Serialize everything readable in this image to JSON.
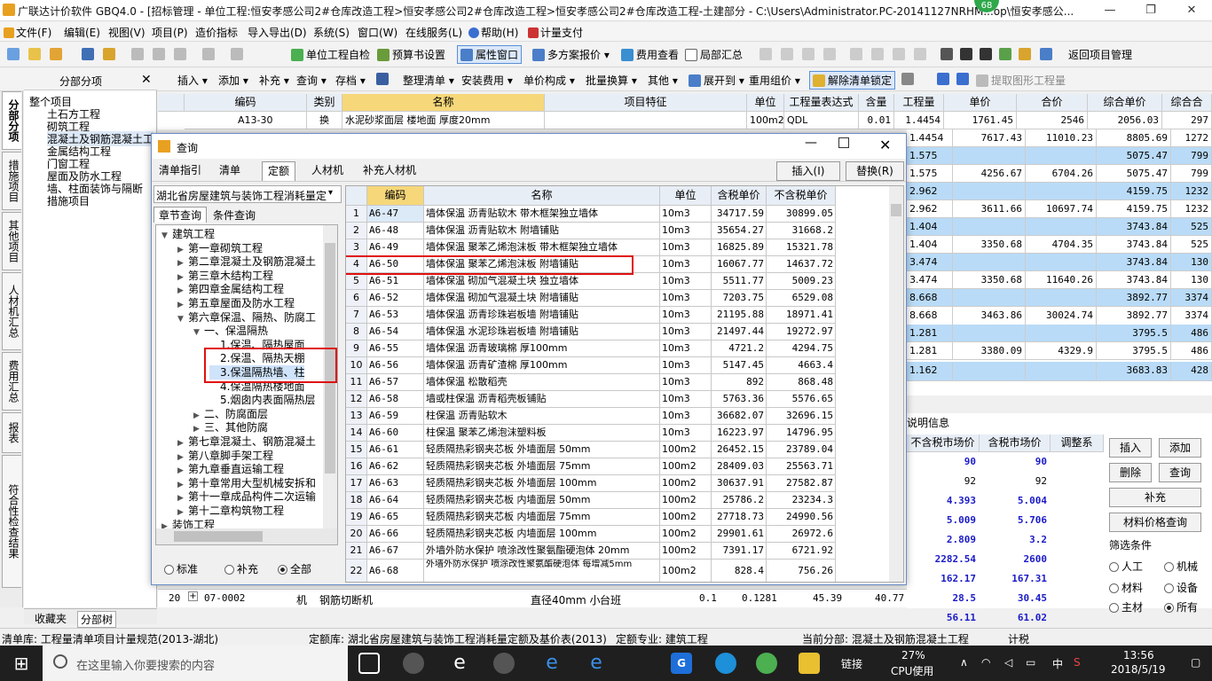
{
  "window": {
    "title": "广联达计价软件 GBQ4.0 - [招标管理 - 单位工程:恒安孝感公司2#仓库改造工程>恒安孝感公司2#仓库改造工程>恒安孝感公司2#仓库改造工程-土建部分 - C:\\Users\\Administrator.PC-20141127NRHM...op\\恒安孝感公...",
    "badge": "68",
    "min": "—",
    "restore": "❐",
    "close": "✕"
  },
  "menu": [
    "文件(F)",
    "编辑(E)",
    "视图(V)",
    "项目(P)",
    "造价指标",
    "导入导出(D)",
    "系统(S)",
    "窗口(W)",
    "在线服务(L)",
    "帮助(H)",
    "计量支付"
  ],
  "toolbar1": {
    "check": "单位工程自检",
    "budget": "预算书设置",
    "prop": "属性窗口",
    "multi": "多方案报价",
    "fee": "费用查看",
    "local": "局部汇总",
    "back": "返回项目管理"
  },
  "toolbar2": {
    "insert": "插入",
    "add": "添加",
    "supplement": "补充",
    "query": "查询",
    "save": "存档",
    "sort": "整理清单",
    "install": "安装费用",
    "unit": "单价构成",
    "batch": "批量换算",
    "other": "其他",
    "expand": "展开到",
    "reprice": "重用组价",
    "unlock": "解除清单锁定",
    "extract": "提取图形工程量"
  },
  "vtabs": [
    "分部分项",
    "措施项目",
    "其他项目",
    "人材机汇总",
    "费用汇总",
    "报表",
    "符合性检查结果"
  ],
  "left": {
    "header": "分部分项",
    "close": "✕",
    "root": "整个项目",
    "items": [
      "土石方工程",
      "砌筑工程",
      "混凝土及钢筋混凝土工",
      "金属结构工程",
      "门窗工程",
      "屋面及防水工程",
      "墙、柱面装饰与隔断",
      "措施项目"
    ],
    "tabs": [
      "收藏夹",
      "分部树"
    ]
  },
  "grid": {
    "headers": [
      "编码",
      "类别",
      "名称",
      "项目特征",
      "单位",
      "工程量表达式",
      "含量",
      "工程量",
      "单价",
      "合价",
      "综合单价",
      "综合合"
    ],
    "row1": {
      "code": "A13-30",
      "cat": "换",
      "name": "水泥砂浆面层 楼地面 厚度20mm",
      "unit": "100m2",
      "expr": "QDL",
      "content": "0.01",
      "qty": "1.4454",
      "price": "1761.45",
      "total": "2546",
      "cprice": "2056.03",
      "ctotal": "297"
    }
  },
  "right_rows": [
    {
      "qty": "1.4454",
      "price": "7617.43",
      "total": "11010.23",
      "cprice": "8805.69",
      "ctotal": "1272",
      "blue": false
    },
    {
      "qty": "1.575",
      "price": "",
      "total": "",
      "cprice": "5075.47",
      "ctotal": "799",
      "blue": true
    },
    {
      "qty": "1.575",
      "price": "4256.67",
      "total": "6704.26",
      "cprice": "5075.47",
      "ctotal": "799",
      "blue": false
    },
    {
      "qty": "2.962",
      "price": "",
      "total": "",
      "cprice": "4159.75",
      "ctotal": "1232",
      "blue": true
    },
    {
      "qty": "2.962",
      "price": "3611.66",
      "total": "10697.74",
      "cprice": "4159.75",
      "ctotal": "1232",
      "blue": false
    },
    {
      "qty": "1.404",
      "price": "",
      "total": "",
      "cprice": "3743.84",
      "ctotal": "525",
      "blue": true
    },
    {
      "qty": "1.404",
      "price": "3350.68",
      "total": "4704.35",
      "cprice": "3743.84",
      "ctotal": "525",
      "blue": false
    },
    {
      "qty": "3.474",
      "price": "",
      "total": "",
      "cprice": "3743.84",
      "ctotal": "130",
      "blue": true
    },
    {
      "qty": "3.474",
      "price": "3350.68",
      "total": "11640.26",
      "cprice": "3743.84",
      "ctotal": "130",
      "blue": false
    },
    {
      "qty": "8.668",
      "price": "",
      "total": "",
      "cprice": "3892.77",
      "ctotal": "3374",
      "blue": true
    },
    {
      "qty": "8.668",
      "price": "3463.86",
      "total": "30024.74",
      "cprice": "3892.77",
      "ctotal": "3374",
      "blue": false
    },
    {
      "qty": "1.281",
      "price": "",
      "total": "",
      "cprice": "3795.5",
      "ctotal": "486",
      "blue": true
    },
    {
      "qty": "1.281",
      "price": "3380.09",
      "total": "4329.9",
      "cprice": "3795.5",
      "ctotal": "486",
      "blue": false
    },
    {
      "qty": "1.162",
      "price": "",
      "total": "",
      "cprice": "3683.83",
      "ctotal": "428",
      "blue": true
    }
  ],
  "bottom": {
    "tab": "说明信息",
    "headers": [
      "不含税市场价",
      "含税市场价",
      "调整系"
    ],
    "rows": [
      {
        "a": "90",
        "b": "90",
        "bold": true
      },
      {
        "a": "92",
        "b": "92",
        "bold": false
      },
      {
        "a": "4.393",
        "b": "5.004",
        "bold": true
      },
      {
        "a": "5.009",
        "b": "5.706",
        "bold": true
      },
      {
        "a": "2.809",
        "b": "3.2",
        "bold": true
      },
      {
        "a": "2282.54",
        "b": "2600",
        "bold": true
      },
      {
        "a": "162.17",
        "b": "167.31",
        "bold": true
      },
      {
        "a": "28.5",
        "b": "30.45",
        "bold": true
      },
      {
        "a": "56.11",
        "b": "61.02",
        "bold": true
      }
    ],
    "buttons": {
      "insert": "插入",
      "add": "添加",
      "delete": "删除",
      "query": "查询",
      "supplement": "补充",
      "material": "材料价格查询"
    },
    "filter": {
      "title": "筛选条件",
      "opts": [
        "人工",
        "机械",
        "材料",
        "设备",
        "主材",
        "所有"
      ]
    }
  },
  "row20": {
    "no": "20",
    "code": "07-0002",
    "cat": "机",
    "name": "钢筋切断机",
    "spec": "直径40mm 小",
    "unit": "台班",
    "v1": "0.1",
    "v2": "0.1281",
    "v3": "45.39",
    "v4": "40.77"
  },
  "status": {
    "list": "清单库:  工程量清单项目计量规范(2013-湖北)",
    "quota": "定额库:  湖北省房屋建筑与装饰工程消耗量定额及基价表(2013)",
    "major": "定额专业:  建筑工程",
    "current": "当前分部:  混凝土及钢筋混凝土工程",
    "tax": "计税"
  },
  "taskbar": {
    "search": "在这里输入你要搜索的内容",
    "link": "链接",
    "cpu": "27%",
    "cpu_label": "CPU使用",
    "ime": "中",
    "time": "13:56",
    "date": "2018/5/19"
  },
  "dialog": {
    "title": "查询",
    "tabs": [
      "清单指引",
      "清单",
      "定额",
      "人材机",
      "补充人材机"
    ],
    "insert": "插入(I)",
    "replace": "替换(R)",
    "lib": "湖北省房屋建筑与装饰工程消耗量定",
    "subtabs": [
      "章节查询",
      "条件查询"
    ],
    "tree": [
      {
        "t": "建筑工程",
        "l": 0,
        "ar": "v"
      },
      {
        "t": "第一章砌筑工程",
        "l": 1,
        "ar": ">"
      },
      {
        "t": "第二章混凝土及钢筋混凝土",
        "l": 1,
        "ar": ">"
      },
      {
        "t": "第三章木结构工程",
        "l": 1,
        "ar": ">"
      },
      {
        "t": "第四章金属结构工程",
        "l": 1,
        "ar": ">"
      },
      {
        "t": "第五章屋面及防水工程",
        "l": 1,
        "ar": ">"
      },
      {
        "t": "第六章保温、隔热、防腐工",
        "l": 1,
        "ar": "v"
      },
      {
        "t": "一、保温隔热",
        "l": 2,
        "ar": "v"
      },
      {
        "t": "1.保温、隔热屋面",
        "l": 3,
        "ar": ""
      },
      {
        "t": "2.保温、隔热天棚",
        "l": 3,
        "ar": ""
      },
      {
        "t": "3.保温隔热墙、柱",
        "l": 3,
        "ar": "",
        "sel": true
      },
      {
        "t": "4.保温隔热楼地面",
        "l": 3,
        "ar": ""
      },
      {
        "t": "5.烟囱内表面隔热层",
        "l": 3,
        "ar": ""
      },
      {
        "t": "二、防腐面层",
        "l": 2,
        "ar": ">"
      },
      {
        "t": "三、其他防腐",
        "l": 2,
        "ar": ">"
      },
      {
        "t": "第七章混凝土、钢筋混凝土",
        "l": 1,
        "ar": ">"
      },
      {
        "t": "第八章脚手架工程",
        "l": 1,
        "ar": ">"
      },
      {
        "t": "第九章垂直运输工程",
        "l": 1,
        "ar": ">"
      },
      {
        "t": "第十章常用大型机械安拆和",
        "l": 1,
        "ar": ">"
      },
      {
        "t": "第十一章成品构件二次运输",
        "l": 1,
        "ar": ">"
      },
      {
        "t": "第十二章构筑物工程",
        "l": 1,
        "ar": ">"
      },
      {
        "t": "装饰工程",
        "l": 0,
        "ar": ">"
      }
    ],
    "radios": [
      "标准",
      "补充",
      "全部"
    ],
    "headers": [
      "编码",
      "名称",
      "单位",
      "含税单价",
      "不含税单价"
    ],
    "rows": [
      [
        "1",
        "A6-47",
        "墙体保温 沥青贴软木 带木框架独立墙体",
        "10m3",
        "34717.59",
        "30899.05"
      ],
      [
        "2",
        "A6-48",
        "墙体保温 沥青贴软木 附墙铺贴",
        "10m3",
        "35654.27",
        "31668.2"
      ],
      [
        "3",
        "A6-49",
        "墙体保温 聚苯乙烯泡沫板 带木框架独立墙体",
        "10m3",
        "16825.89",
        "15321.78"
      ],
      [
        "4",
        "A6-50",
        "墙体保温 聚苯乙烯泡沫板 附墙铺贴",
        "10m3",
        "16067.77",
        "14637.72"
      ],
      [
        "5",
        "A6-51",
        "墙体保温 砌加气混凝土块 独立墙体",
        "10m3",
        "5511.77",
        "5009.23"
      ],
      [
        "6",
        "A6-52",
        "墙体保温 砌加气混凝土块 附墙铺贴",
        "10m3",
        "7203.75",
        "6529.08"
      ],
      [
        "7",
        "A6-53",
        "墙体保温 沥青珍珠岩板墙 附墙铺贴",
        "10m3",
        "21195.88",
        "18971.41"
      ],
      [
        "8",
        "A6-54",
        "墙体保温 水泥珍珠岩板墙 附墙铺贴",
        "10m3",
        "21497.44",
        "19272.97"
      ],
      [
        "9",
        "A6-55",
        "墙体保温 沥青玻璃棉 厚100mm",
        "10m3",
        "4721.2",
        "4294.75"
      ],
      [
        "10",
        "A6-56",
        "墙体保温 沥青矿渣棉 厚100mm",
        "10m3",
        "5147.45",
        "4663.4"
      ],
      [
        "11",
        "A6-57",
        "墙体保温 松散稻壳",
        "10m3",
        "892",
        "868.48"
      ],
      [
        "12",
        "A6-58",
        "墙或柱保温 沥青稻壳板铺贴",
        "10m3",
        "5763.36",
        "5576.65"
      ],
      [
        "13",
        "A6-59",
        "柱保温 沥青贴软木",
        "10m3",
        "36682.07",
        "32696.15"
      ],
      [
        "14",
        "A6-60",
        "柱保温 聚苯乙烯泡沫塑料板",
        "10m3",
        "16223.97",
        "14796.95"
      ],
      [
        "15",
        "A6-61",
        "轻质隔热彩钢夹芯板 外墙面层 50mm",
        "100m2",
        "26452.15",
        "23789.04"
      ],
      [
        "16",
        "A6-62",
        "轻质隔热彩钢夹芯板 外墙面层 75mm",
        "100m2",
        "28409.03",
        "25563.71"
      ],
      [
        "17",
        "A6-63",
        "轻质隔热彩钢夹芯板 外墙面层 100mm",
        "100m2",
        "30637.91",
        "27582.87"
      ],
      [
        "18",
        "A6-64",
        "轻质隔热彩钢夹芯板 内墙面层 50mm",
        "100m2",
        "25786.2",
        "23234.3"
      ],
      [
        "19",
        "A6-65",
        "轻质隔热彩钢夹芯板 内墙面层 75mm",
        "100m2",
        "27718.73",
        "24990.56"
      ],
      [
        "20",
        "A6-66",
        "轻质隔热彩钢夹芯板 内墙面层 100mm",
        "100m2",
        "29901.61",
        "26972.6"
      ],
      [
        "21",
        "A6-67",
        "外墙外防水保护 喷涂改性聚氨酯硬泡体 20mm",
        "100m2",
        "7391.17",
        "6721.92"
      ],
      [
        "22",
        "A6-68",
        "外墙外防水保护 喷涂改性聚氨酯硬泡体 每增减5mm",
        "100m2",
        "828.4",
        "756.26"
      ]
    ]
  }
}
